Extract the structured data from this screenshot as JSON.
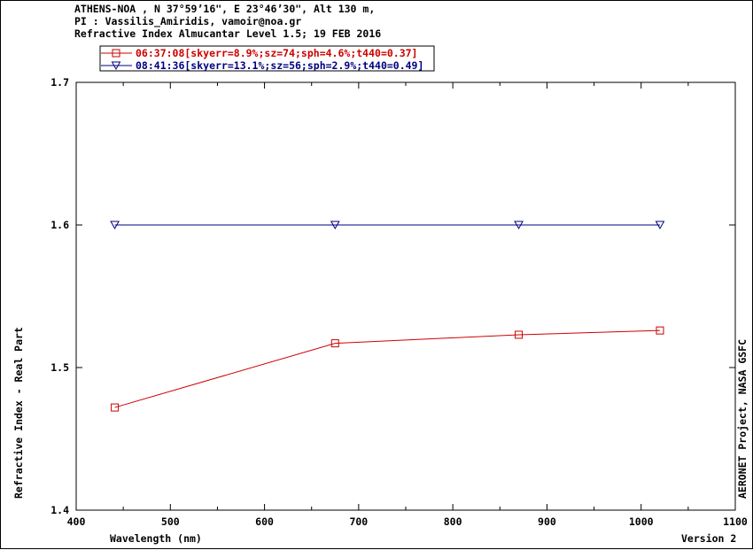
{
  "header": {
    "line1": "ATHENS-NOA , N 37°59’16\", E 23°46’30\", Alt 130 m,",
    "line2": "PI : Vassilis_Amiridis, vamoir@noa.gr",
    "line3": "Refractive Index Almucantar Level 1.5; 19 FEB 2016"
  },
  "footer": {
    "version": "Version 2",
    "side_label": "AERONET Project, NASA GSFC"
  },
  "colors": {
    "series1": "#cc0000",
    "series2": "#000080",
    "axis": "#000000"
  },
  "chart_data": {
    "type": "line",
    "xlabel": "Wavelength (nm)",
    "ylabel": "Refractive Index - Real Part",
    "xlim": [
      400,
      1100
    ],
    "ylim": [
      1.4,
      1.7
    ],
    "xticks": [
      400,
      500,
      600,
      700,
      800,
      900,
      1000,
      1100
    ],
    "yticks": [
      1.4,
      1.5,
      1.6,
      1.7
    ],
    "grid": false,
    "legend_position": "top-left",
    "series": [
      {
        "name": "06:37:08[skyerr=8.9%;sz=74;sph=4.6%;t440=0.37]",
        "marker": "square",
        "x": [
          441,
          675,
          870,
          1020
        ],
        "y": [
          1.472,
          1.517,
          1.523,
          1.526
        ]
      },
      {
        "name": "08:41:36[skyerr=13.1%;sz=56;sph=2.9%;t440=0.49]",
        "marker": "triangle-down",
        "x": [
          441,
          675,
          870,
          1020
        ],
        "y": [
          1.6,
          1.6,
          1.6,
          1.6
        ]
      }
    ]
  }
}
